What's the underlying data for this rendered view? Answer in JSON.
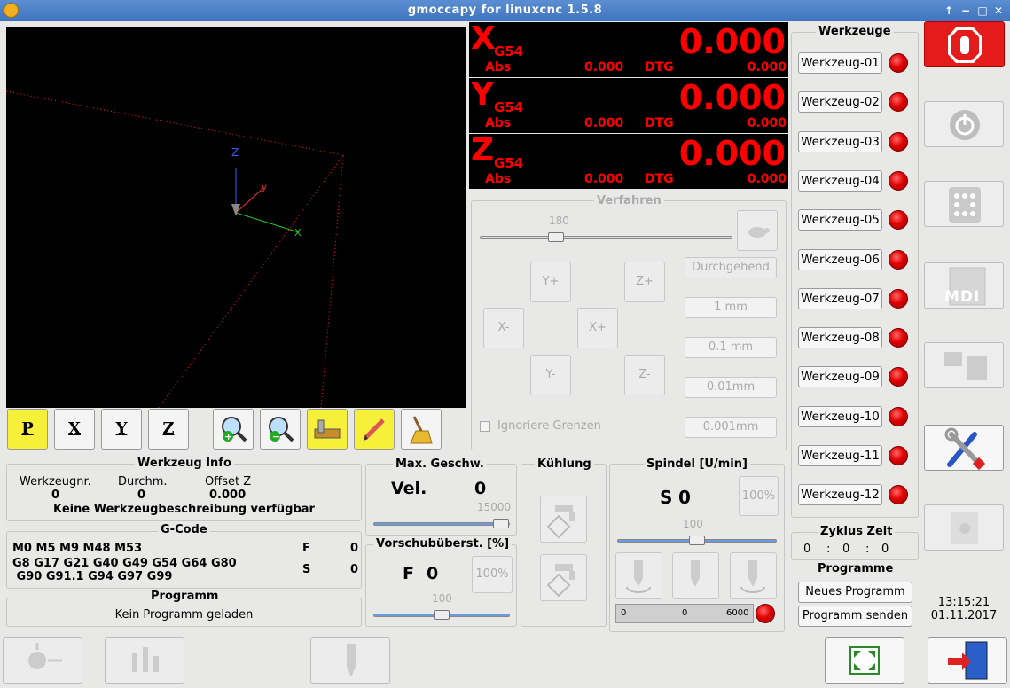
{
  "window": {
    "title": "gmoccapy for linuxcnc  1.5.8"
  },
  "colors": {
    "accent_red": "#ee0000",
    "led_red": "#e00000",
    "titlebar": "#4a7fc8",
    "preview_bg": "#000000",
    "dro_text": "#ff0000"
  },
  "preview": {
    "axis_labels": [
      "Z",
      "X"
    ],
    "toolbar": [
      {
        "label": "P",
        "icon": "perspective-view-icon"
      },
      {
        "label": "X",
        "icon": "view-x-icon"
      },
      {
        "label": "Y",
        "icon": "view-y-icon"
      },
      {
        "label": "Z",
        "icon": "view-z-icon"
      },
      {
        "icon": "zoom-in-icon"
      },
      {
        "icon": "zoom-out-icon"
      },
      {
        "icon": "show-dimensions-icon"
      },
      {
        "icon": "edit-pencil-icon"
      },
      {
        "icon": "clear-broom-icon"
      }
    ]
  },
  "dro": [
    {
      "axis": "X",
      "coord": "G54",
      "value": "0.000",
      "abs_label": "Abs",
      "abs": "0.000",
      "dtg_label": "DTG",
      "dtg": "0.000"
    },
    {
      "axis": "Y",
      "coord": "G54",
      "value": "0.000",
      "abs_label": "Abs",
      "abs": "0.000",
      "dtg_label": "DTG",
      "dtg": "0.000"
    },
    {
      "axis": "Z",
      "coord": "G54",
      "value": "0.000",
      "abs_label": "Abs",
      "abs": "0.000",
      "dtg_label": "DTG",
      "dtg": "0.000"
    }
  ],
  "jog": {
    "title": "Verfahren",
    "speed": "180",
    "speed_fraction": 0.29,
    "buttons": {
      "y_plus": "Y+",
      "z_plus": "Z+",
      "x_minus": "X-",
      "x_plus": "X+",
      "y_minus": "Y-",
      "z_minus": "Z-"
    },
    "increments": [
      "Durchgehend",
      "1 mm",
      "0.1 mm",
      "0.01mm",
      "0.001mm"
    ],
    "ignore_limits": "Ignoriere Grenzen"
  },
  "tools": {
    "title": "Werkzeuge",
    "items": [
      "Werkzeug-01",
      "Werkzeug-02",
      "Werkzeug-03",
      "Werkzeug-04",
      "Werkzeug-05",
      "Werkzeug-06",
      "Werkzeug-07",
      "Werkzeug-08",
      "Werkzeug-09",
      "Werkzeug-10",
      "Werkzeug-11",
      "Werkzeug-12"
    ]
  },
  "cycle": {
    "title": "Zyklus Zeit",
    "h": "0",
    "sep1": ":",
    "m": "0",
    "sep2": ":",
    "s": "0"
  },
  "programs": {
    "title": "Programme",
    "new": "Neues Programm",
    "send": "Programm senden"
  },
  "clock": {
    "time": "13:15:21",
    "date": "01.11.2017"
  },
  "tool_info": {
    "title": "Werkzeug Info",
    "nr_label": "Werkzeugnr.",
    "nr": "0",
    "dia_label": "Durchm.",
    "dia": "0",
    "offset_label": "Offset Z",
    "offset": "0.000",
    "desc": "Keine Werkzeugbeschreibung verfügbar"
  },
  "gcode": {
    "title": "G-Code",
    "line1": "M0 M5 M9 M48 M53",
    "line2": "G8 G17 G21 G40 G49 G54 G64 G80",
    "line3": " G90 G91.1 G94 G97 G99",
    "f_label": "F",
    "f": "0",
    "s_label": "S",
    "s": "0"
  },
  "program": {
    "title": "Programm",
    "text": "Kein Programm geladen"
  },
  "max_vel": {
    "title": "Max. Geschw.",
    "label": "Vel.",
    "value": "0",
    "max": "15000",
    "fraction": 0.99
  },
  "feed_override": {
    "title": "Vorschubüberst. [%]",
    "label": "F",
    "value": "0",
    "pct_button": "100%",
    "scale": "100",
    "fraction": 0.5
  },
  "coolant": {
    "title": "Kühlung",
    "icons": [
      "flood-coolant-icon",
      "mist-coolant-icon"
    ]
  },
  "spindle": {
    "title": "Spindel [U/min]",
    "label": "S",
    "value": "0",
    "pct_button": "100%",
    "scale": "100",
    "fraction": 0.5,
    "bar_min": "0",
    "bar_val": "0",
    "bar_max": "6000"
  },
  "right_buttons": [
    "estop-icon",
    "power-icon",
    "manual-mode-icon",
    "mdi-mode-icon",
    "auto-mode-icon",
    "settings-icon",
    "user-tabs-icon"
  ],
  "mdi_label": "MDI",
  "bottom_bar": [
    "touch-off-icon",
    "tool-measure-icon",
    "tool-change-icon",
    "fullscreen-icon",
    "exit-icon"
  ]
}
